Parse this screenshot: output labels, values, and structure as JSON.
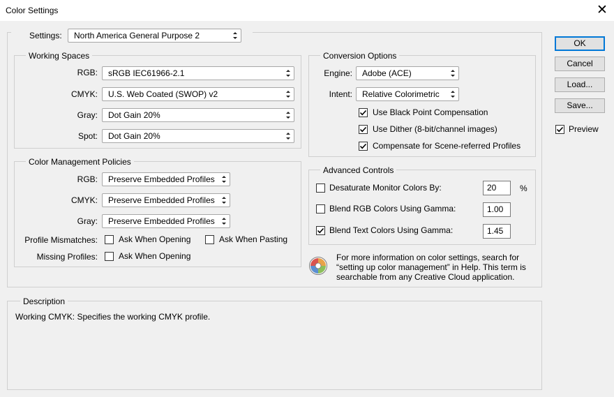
{
  "window": {
    "title": "Color Settings",
    "close_glyph": "✕"
  },
  "settings": {
    "label": "Settings:",
    "value": "North America General Purpose 2"
  },
  "working_spaces": {
    "legend": "Working Spaces",
    "rgb": {
      "label": "RGB:",
      "value": "sRGB IEC61966-2.1"
    },
    "cmyk": {
      "label": "CMYK:",
      "value": "U.S. Web Coated (SWOP) v2"
    },
    "gray": {
      "label": "Gray:",
      "value": "Dot Gain 20%"
    },
    "spot": {
      "label": "Spot:",
      "value": "Dot Gain 20%"
    }
  },
  "policies": {
    "legend": "Color Management Policies",
    "rgb": {
      "label": "RGB:",
      "value": "Preserve Embedded Profiles"
    },
    "cmyk": {
      "label": "CMYK:",
      "value": "Preserve Embedded Profiles"
    },
    "gray": {
      "label": "Gray:",
      "value": "Preserve Embedded Profiles"
    },
    "mismatches": {
      "label": "Profile Mismatches:",
      "opening": "Ask When Opening",
      "pasting": "Ask When Pasting",
      "opening_checked": false,
      "pasting_checked": false
    },
    "missing": {
      "label": "Missing Profiles:",
      "opening": "Ask When Opening",
      "opening_checked": false
    }
  },
  "conversion": {
    "legend": "Conversion Options",
    "engine": {
      "label": "Engine:",
      "value": "Adobe (ACE)"
    },
    "intent": {
      "label": "Intent:",
      "value": "Relative Colorimetric"
    },
    "black_point": {
      "label": "Use Black Point Compensation",
      "checked": true
    },
    "dither": {
      "label": "Use Dither (8-bit/channel images)",
      "checked": true
    },
    "scene_referred": {
      "label": "Compensate for Scene-referred Profiles",
      "checked": true
    }
  },
  "advanced": {
    "legend": "Advanced Controls",
    "desaturate": {
      "label": "Desaturate Monitor Colors By:",
      "value": "20",
      "unit": "%",
      "checked": false
    },
    "blend_rgb": {
      "label": "Blend RGB Colors Using Gamma:",
      "value": "1.00",
      "checked": false
    },
    "blend_text": {
      "label": "Blend Text Colors Using Gamma:",
      "value": "1.45",
      "checked": true
    }
  },
  "info": {
    "icon": "color-wheel-icon",
    "line1": "For more information on color settings, search for",
    "line2": "“setting up color management” in Help. This term is",
    "line3": "searchable from any Creative Cloud application."
  },
  "description": {
    "legend": "Description",
    "text": "Working CMYK:  Specifies the working CMYK profile."
  },
  "buttons": {
    "ok": "OK",
    "cancel": "Cancel",
    "load": "Load...",
    "save": "Save...",
    "preview": "Preview",
    "preview_checked": true
  },
  "colors": {
    "accent": "#0078d7",
    "background": "#f0f0f0",
    "border": "#cfcfcf"
  }
}
